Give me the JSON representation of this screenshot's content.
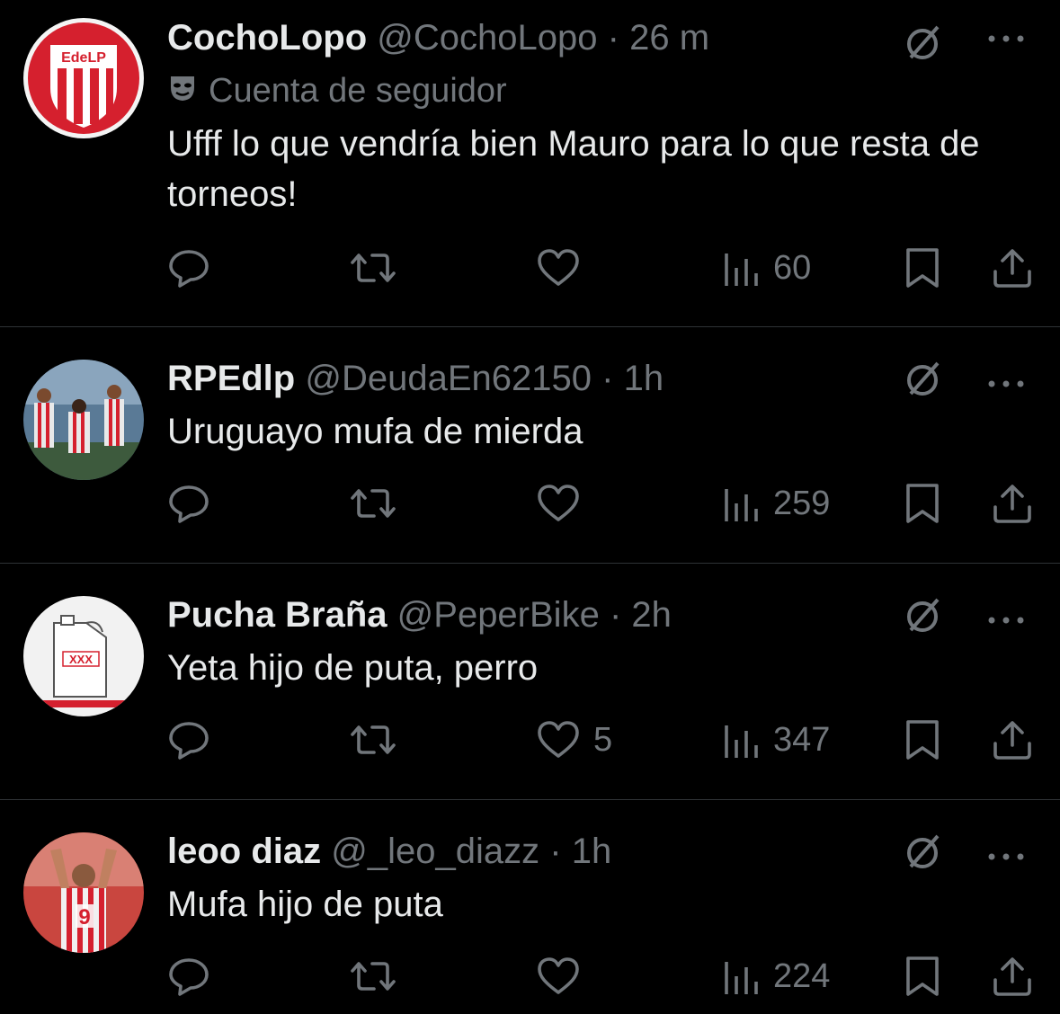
{
  "tweets": [
    {
      "name": "CochoLopo",
      "handle": "@CochoLopo",
      "separator": "·",
      "time": "26 m",
      "subline": "Cuenta de seguidor",
      "text": "Ufff lo que vendría bien Mauro para lo que resta de torneos!",
      "likes": "",
      "views": "60",
      "avatar_text": "EdeLP"
    },
    {
      "name": "RPEdlp",
      "handle": "@DeudaEn62150",
      "separator": "·",
      "time": "1h",
      "text": "Uruguayo mufa de mierda",
      "likes": "",
      "views": "259"
    },
    {
      "name": "Pucha Braña",
      "handle": "@PeperBike",
      "separator": "·",
      "time": "2h",
      "text": "Yeta hijo de puta, perro",
      "likes": "5",
      "views": "347",
      "avatar_text": "XXX"
    },
    {
      "name": "leoo diaz",
      "handle": "@_leo_diazz",
      "separator": "·",
      "time": "1h",
      "text": "Mufa hijo de puta",
      "likes": "",
      "views": "224",
      "avatar_text": "9"
    }
  ],
  "icons": {
    "reply": "reply-icon",
    "retweet": "retweet-icon",
    "like": "heart-icon",
    "views": "views-icon",
    "bookmark": "bookmark-icon",
    "share": "share-icon",
    "grok": "grok-icon",
    "more": "more-icon"
  },
  "colors": {
    "background": "#000000",
    "text": "#e7e9ea",
    "muted": "#71767b",
    "divider": "#2f3336",
    "club_red": "#d5202e"
  }
}
